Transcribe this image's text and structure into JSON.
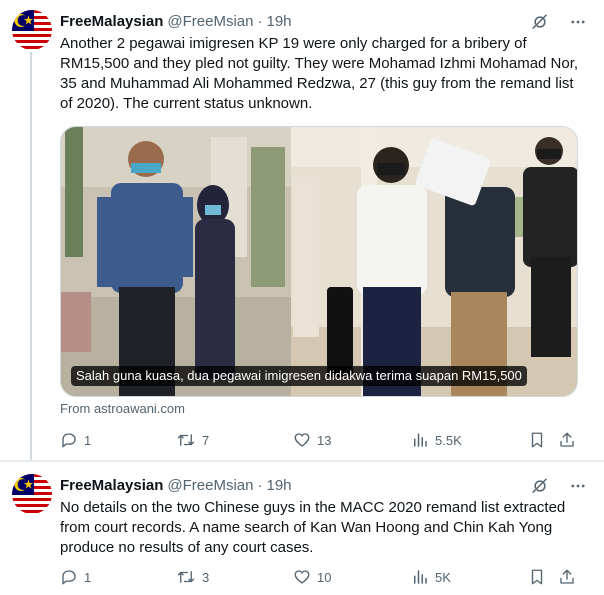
{
  "tweets": [
    {
      "name": "FreeMalaysian",
      "handle": "@FreeMsian",
      "dot": "·",
      "time": "19h",
      "text": "Another 2 pegawai imigresen KP 19 were only charged for a bribery of RM15,500 and they pled not guilty. They were Mohamad Izhmi Mohamad Nor, 35 and  Muhammad Ali Mohammed Redzwa, 27 (this guy from the remand list of 2020). The current status unknown.",
      "media_caption": "Salah guna kuasa, dua pegawai imigresen didakwa terima suapan RM15,500",
      "source": "From astroawani.com",
      "replies": "1",
      "retweets": "7",
      "likes": "13",
      "views": "5.5K"
    },
    {
      "name": "FreeMalaysian",
      "handle": "@FreeMsian",
      "dot": "·",
      "time": "19h",
      "text": "No details on the two Chinese guys in the MACC 2020 remand list extracted from court records. A name search of Kan Wan Hoong and Chin Kah Yong produce no results of any court cases.",
      "replies": "1",
      "retweets": "3",
      "likes": "10",
      "views": "5K"
    }
  ],
  "colors": {
    "text": "#0f1419",
    "muted": "#536471",
    "border": "#cfd9de"
  },
  "icons": [
    "malaysia-flag-avatar",
    "grok-icon",
    "more-icon",
    "reply-icon",
    "retweet-icon",
    "like-icon",
    "views-icon",
    "bookmark-icon",
    "share-icon"
  ]
}
